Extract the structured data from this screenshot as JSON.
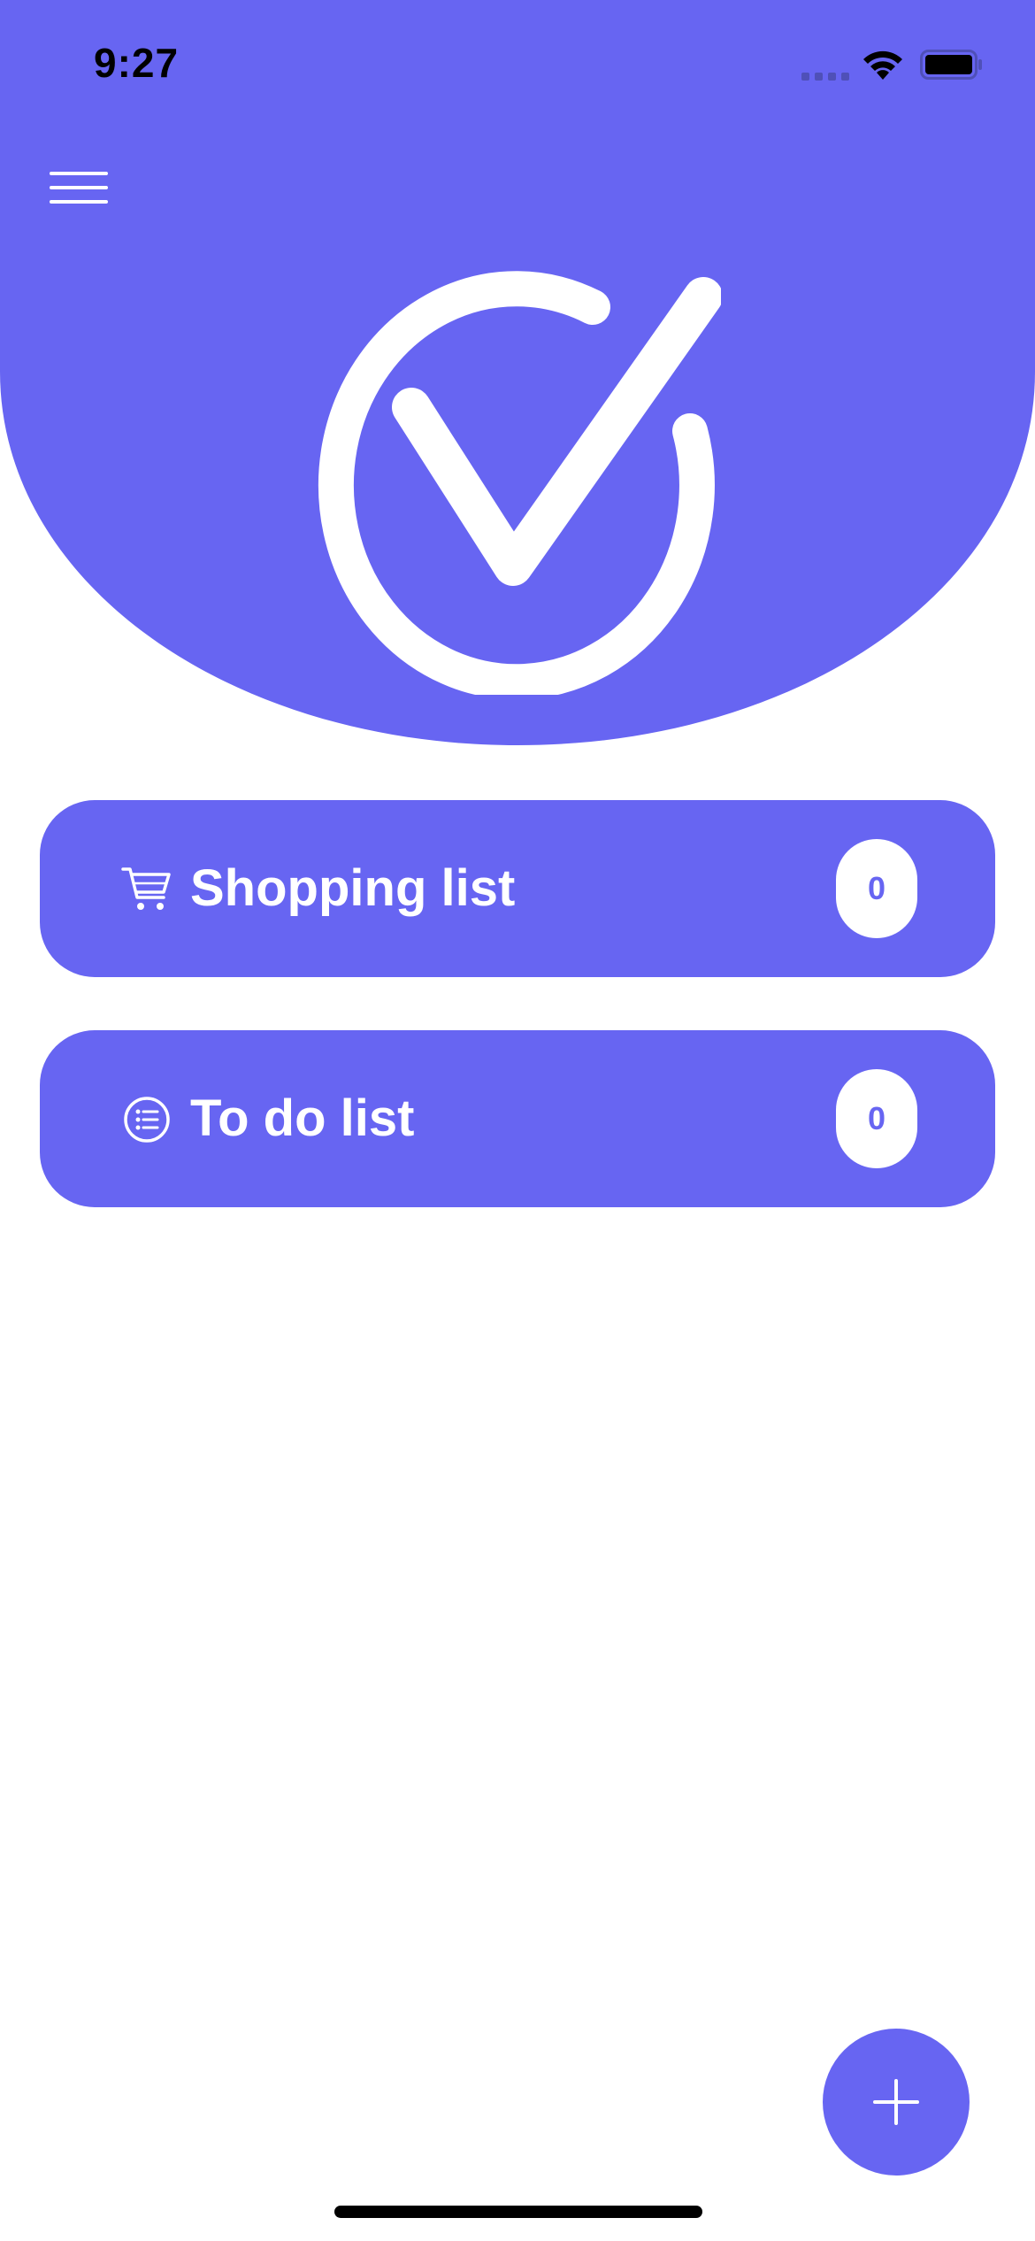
{
  "status_bar": {
    "time": "9:27"
  },
  "theme": {
    "accent": "#6765f2",
    "background": "#ffffff",
    "on_accent": "#ffffff"
  },
  "header": {
    "menu_icon": "hamburger-menu-icon",
    "logo_icon": "checkmark-circle-icon"
  },
  "lists": [
    {
      "label": "Shopping list",
      "icon": "shopping-cart-icon",
      "count": "0"
    },
    {
      "label": "To do list",
      "icon": "list-bullet-icon",
      "count": "0"
    }
  ],
  "fab": {
    "icon": "plus-icon"
  }
}
